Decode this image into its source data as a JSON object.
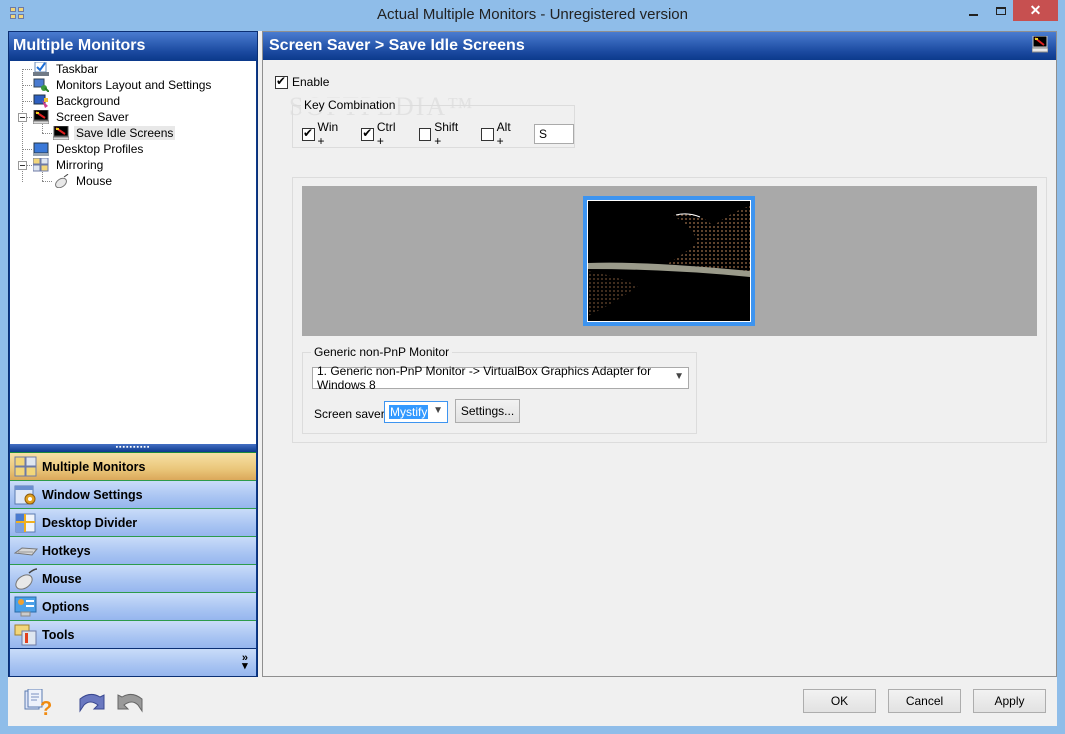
{
  "window": {
    "title": "Actual Multiple Monitors - Unregistered version",
    "minimize_label": "",
    "maximize_label": "",
    "close_label": "✕"
  },
  "left_pane": {
    "header": "Multiple Monitors",
    "tree": [
      {
        "label": "Taskbar",
        "icon": "taskbar-icon",
        "level": 0
      },
      {
        "label": "Monitors Layout and Settings",
        "icon": "monitors-layout-icon",
        "level": 0
      },
      {
        "label": "Background",
        "icon": "background-icon",
        "level": 0
      },
      {
        "label": "Screen Saver",
        "icon": "screen-saver-icon",
        "level": 0,
        "expanded": true
      },
      {
        "label": "Save Idle Screens",
        "icon": "screen-saver-icon",
        "level": 1,
        "selected": true
      },
      {
        "label": "Desktop Profiles",
        "icon": "desktop-profiles-icon",
        "level": 0
      },
      {
        "label": "Mirroring",
        "icon": "mirroring-icon",
        "level": 0,
        "expanded": true
      },
      {
        "label": "Mouse",
        "icon": "mouse-icon",
        "level": 1
      }
    ],
    "splitter_grip": "▪▪▪▪▪▪▪▪▪▪",
    "nav": [
      {
        "label": "Multiple Monitors",
        "icon": "multiple-monitors-icon",
        "active": true
      },
      {
        "label": "Window Settings",
        "icon": "window-settings-icon"
      },
      {
        "label": "Desktop Divider",
        "icon": "desktop-divider-icon"
      },
      {
        "label": "Hotkeys",
        "icon": "keyboard-icon"
      },
      {
        "label": "Mouse",
        "icon": "mouse-icon"
      },
      {
        "label": "Options",
        "icon": "options-icon"
      },
      {
        "label": "Tools",
        "icon": "tools-icon"
      }
    ],
    "more_chevron": "»"
  },
  "right_pane": {
    "header": "Screen Saver > Save Idle Screens",
    "enable": {
      "label": "Enable",
      "checked": true
    },
    "key_combination": {
      "legend": "Key Combination",
      "keys": [
        {
          "label": "Win +",
          "checked": true
        },
        {
          "label": "Ctrl +",
          "checked": true
        },
        {
          "label": "Shift +",
          "checked": false
        },
        {
          "label": "Alt +",
          "checked": false
        }
      ],
      "key_value": "S"
    },
    "watermark": "SOFTPEDIA™",
    "monitor_group": {
      "legend": "Generic non-PnP Monitor",
      "monitor_select": "1. Generic non-PnP Monitor -> VirtualBox Graphics Adapter for Windows 8",
      "screen_saver_label": "Screen saver:",
      "screen_saver_value": "Mystify",
      "settings_button": "Settings..."
    }
  },
  "bottom": {
    "ok": "OK",
    "cancel": "Cancel",
    "apply": "Apply"
  },
  "colors": {
    "header_blue": "#0c3a8c",
    "active_nav": "#eac67a",
    "nav_blue": "#a8c4f2",
    "monitor_highlight": "#3d94f0",
    "close_red": "#c75050"
  }
}
